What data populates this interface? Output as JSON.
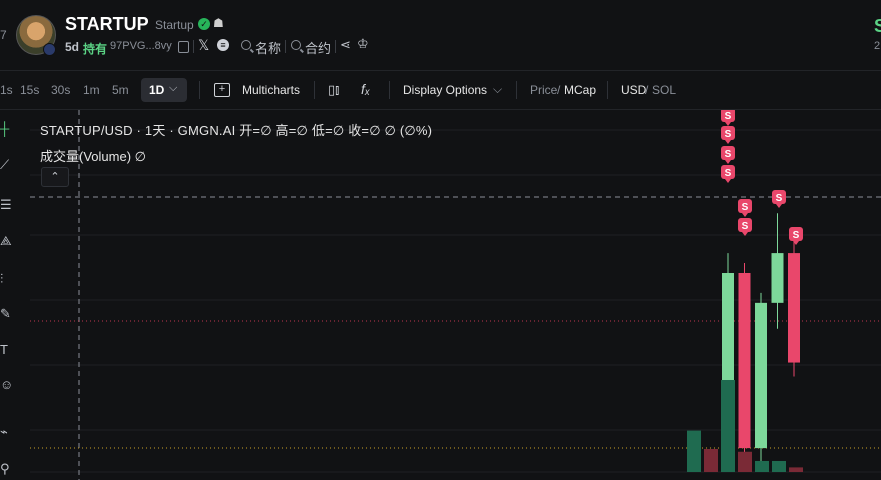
{
  "header": {
    "edge_number": "7",
    "token_name": "STARTUP",
    "token_sub": "Startup",
    "age": "5d",
    "holding_label": "持有",
    "address": "97PVG...8vy",
    "name_link": "名称",
    "contract_link": "合约",
    "right_symbol": "S",
    "right_sub": "2"
  },
  "toolbar": {
    "partial_timeframe": "1s",
    "timeframes": [
      "15s",
      "30s",
      "1m",
      "5m"
    ],
    "active_timeframe": "1D",
    "multicharts": "Multicharts",
    "display_options": "Display Options",
    "price_label": "Price",
    "mcap_label": "MCap",
    "usd_label": "USD",
    "sol_label": "SOL",
    "slash": "/"
  },
  "legend": {
    "title": "STARTUP/USD · 1天 · GMGN.AI  开=∅  高=∅  低=∅  收=∅  ∅ (∅%)",
    "volume": "成交量(Volume)  ∅"
  },
  "chart_data": {
    "type": "candlestick",
    "candles": [
      {
        "dir": "up",
        "open": 0.0,
        "close": 1.0,
        "high": 1.1,
        "low": -0.1
      },
      {
        "dir": "down",
        "open": 1.0,
        "close": 0.12,
        "high": 1.05,
        "low": 0.05
      },
      {
        "dir": "up",
        "open": 0.12,
        "close": 0.85,
        "high": 0.9,
        "low": 0.0
      },
      {
        "dir": "up",
        "open": 0.85,
        "close": 1.1,
        "high": 1.3,
        "low": 0.72
      },
      {
        "dir": "down",
        "open": 1.1,
        "close": 0.55,
        "high": 1.2,
        "low": 0.48
      }
    ],
    "volume": [
      {
        "dir": "up",
        "value": 0.45
      },
      {
        "dir": "down",
        "value": 0.25
      },
      {
        "dir": "up",
        "value": 1.0
      },
      {
        "dir": "down",
        "value": 0.22
      },
      {
        "dir": "up",
        "value": 0.12
      },
      {
        "dir": "up",
        "value": 0.12
      },
      {
        "dir": "down",
        "value": 0.05
      }
    ],
    "sell_marker_label": "S",
    "colors": {
      "up": "#7dd89a",
      "down": "#e9476b",
      "vol_up": "#1f6b50",
      "vol_down": "#7a2a36",
      "grid": "#1e2024",
      "crosshair": "#8a8f98",
      "price_line": "#c0364f",
      "bottom_line": "#c9a227"
    }
  }
}
